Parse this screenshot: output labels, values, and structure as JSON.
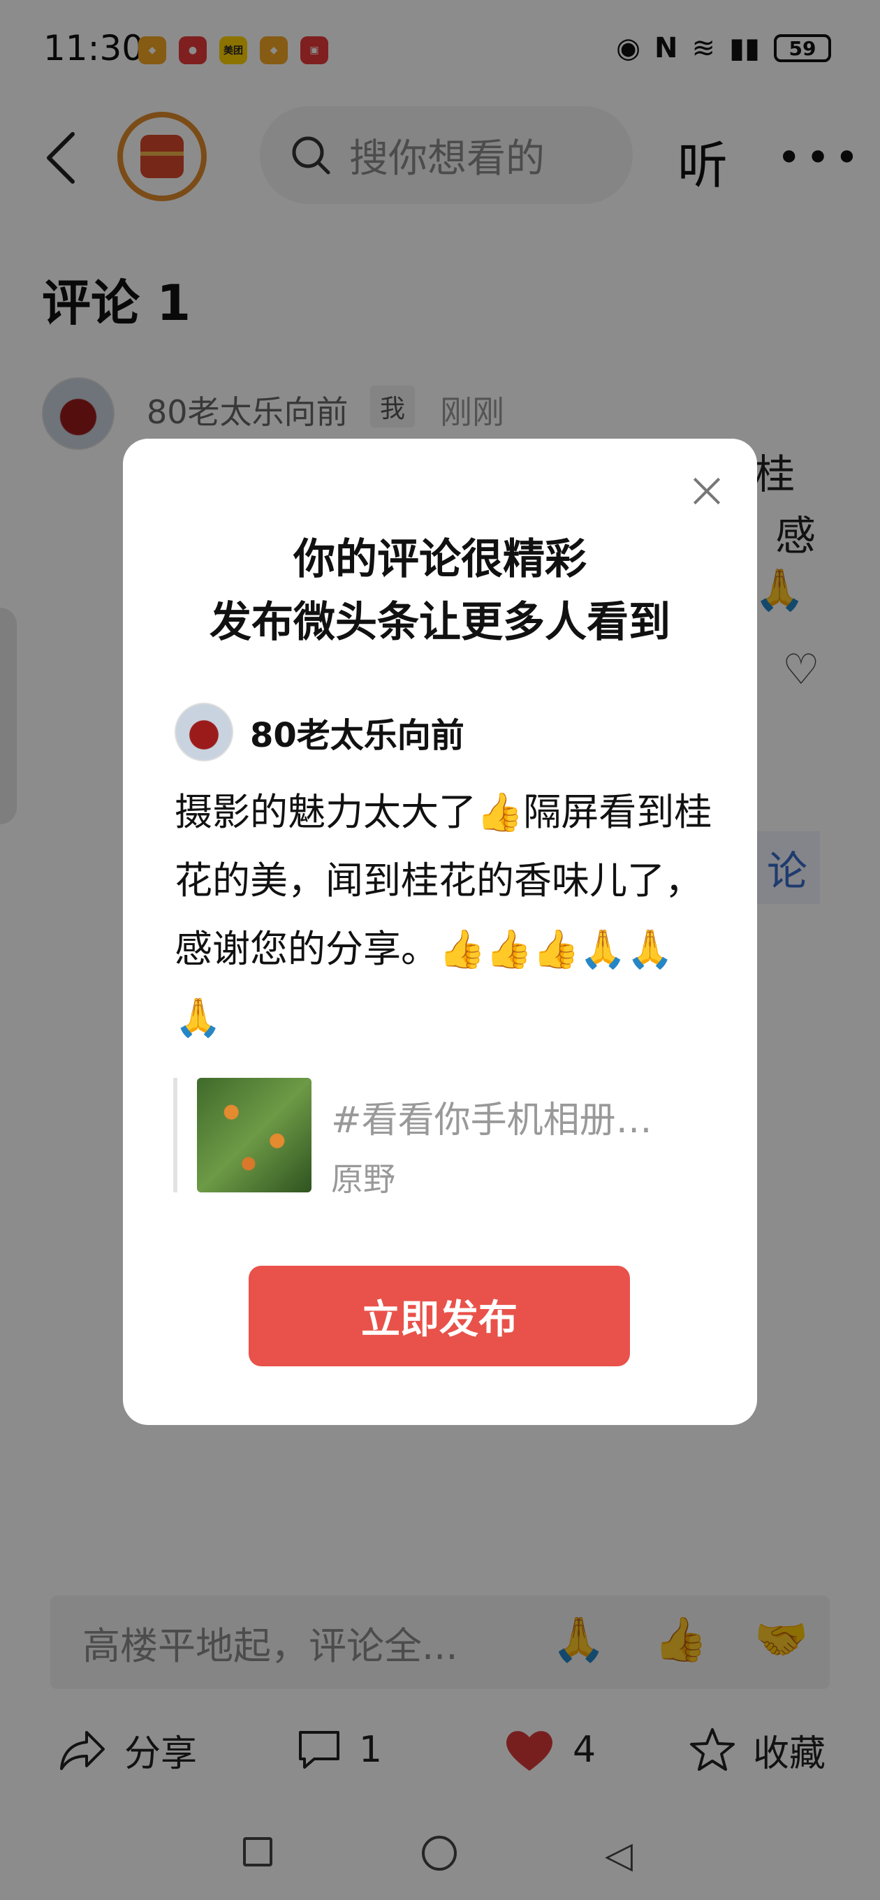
{
  "status_bar": {
    "time": "11:30",
    "battery": "59",
    "app_badge_meituan": "美团"
  },
  "topnav": {
    "search_placeholder": "搜你想看的",
    "listen_label": "听"
  },
  "comments": {
    "title": "评论 1",
    "first": {
      "author": "80老太乐向前",
      "me_tag": "我",
      "time": "刚刚",
      "peek_1": "桂",
      "peek_2": "感",
      "peek_4": "论"
    }
  },
  "comment_bar": {
    "placeholder": "高楼平地起，评论全...",
    "quick_emojis": [
      "🙏",
      "👍",
      "🤝"
    ]
  },
  "actions": {
    "share": "分享",
    "comment_count": "1",
    "like_count": "4",
    "favorite": "收藏"
  },
  "dialog": {
    "title_line1": "你的评论很精彩",
    "title_line2": "发布微头条让更多人看到",
    "username": "80老太乐向前",
    "body_text": "摄影的魅力太大了👍隔屏看到桂花的美，闻到桂花的香味儿了，感谢您的分享。👍👍👍🙏🙏🙏",
    "quote_title": "#看看你手机相册…",
    "quote_sub": "原野",
    "publish_label": "立即发布"
  },
  "colors": {
    "accent": "#e8524a",
    "overlay": "rgba(0,0,0,0.45)",
    "logo_ring": "#e08a2a",
    "like_red": "#d93a3a"
  }
}
